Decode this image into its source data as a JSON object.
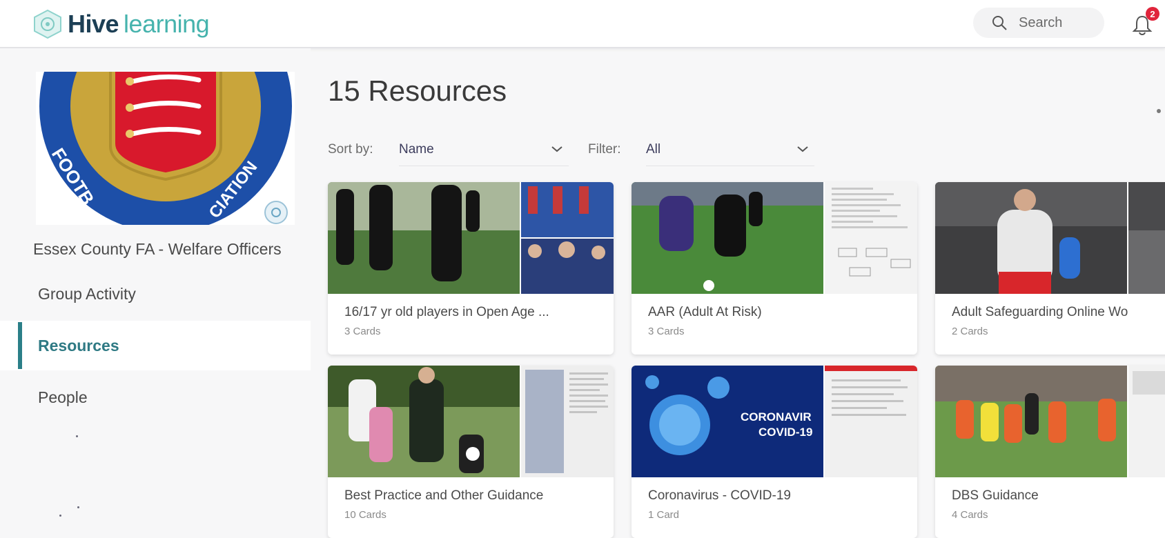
{
  "app": {
    "brand_primary": "Hive",
    "brand_secondary": "learning",
    "brand_color": "#1c3f55",
    "accent_color": "#46b3ad"
  },
  "header": {
    "search_placeholder": "Search",
    "notification_count": "2",
    "search_icon": "search-icon",
    "bell_icon": "bell-icon"
  },
  "sidebar": {
    "group_name": "Essex County FA - Welfare Officers",
    "nav": [
      {
        "label": "Group Activity",
        "active": false
      },
      {
        "label": "Resources",
        "active": true
      },
      {
        "label": "People",
        "active": false
      }
    ],
    "active_color": "#2b7f88"
  },
  "main": {
    "title": "15 Resources",
    "sort_label": "Sort by:",
    "sort_value": "Name",
    "filter_label": "Filter:",
    "filter_value": "All"
  },
  "cards": [
    {
      "title": "16/17 yr old players in Open Age ...",
      "count": "3 Cards"
    },
    {
      "title": "AAR (Adult At Risk)",
      "count": "3 Cards"
    },
    {
      "title": "Adult Safeguarding Online Wo",
      "count": "2 Cards"
    },
    {
      "title": "Best Practice and Other Guidance",
      "count": "10 Cards"
    },
    {
      "title": "Coronavirus - COVID-19",
      "count": "1 Card"
    },
    {
      "title": "DBS Guidance",
      "count": "4 Cards"
    }
  ],
  "thumb_text": {
    "covid_line1": "CORONAVIR",
    "covid_line2": "COVID-19"
  }
}
